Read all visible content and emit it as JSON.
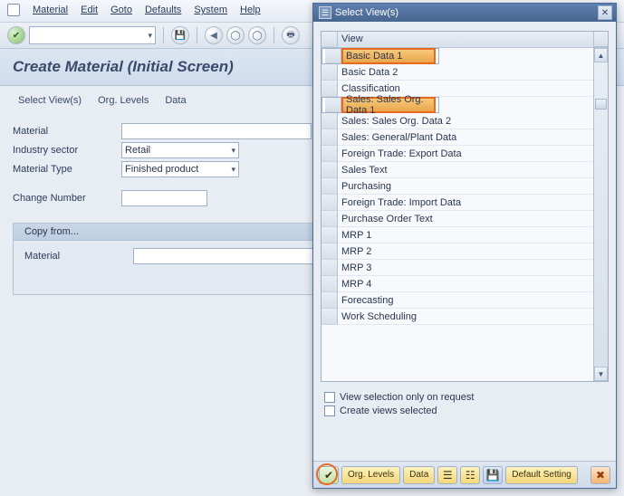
{
  "menubar": {
    "items": [
      "Material",
      "Edit",
      "Goto",
      "Defaults",
      "System",
      "Help"
    ]
  },
  "page_title": "Create Material (Initial Screen)",
  "subtabs": [
    "Select View(s)",
    "Org. Levels",
    "Data"
  ],
  "form": {
    "material_label": "Material",
    "industry_label": "Industry sector",
    "industry_value": "Retail",
    "mtype_label": "Material Type",
    "mtype_value": "Finished product",
    "changeno_label": "Change Number"
  },
  "copybox": {
    "title": "Copy from...",
    "material_label": "Material"
  },
  "dialog": {
    "title": "Select View(s)",
    "header_label": "View",
    "items": [
      {
        "label": "Basic Data 1",
        "selected": true
      },
      {
        "label": "Basic Data 2",
        "selected": false
      },
      {
        "label": "Classification",
        "selected": false
      },
      {
        "label": "Sales: Sales Org. Data 1",
        "selected": true
      },
      {
        "label": "Sales: Sales Org. Data 2",
        "selected": false
      },
      {
        "label": "Sales: General/Plant Data",
        "selected": false
      },
      {
        "label": "Foreign Trade: Export Data",
        "selected": false
      },
      {
        "label": "Sales Text",
        "selected": false
      },
      {
        "label": "Purchasing",
        "selected": false
      },
      {
        "label": "Foreign Trade: Import Data",
        "selected": false
      },
      {
        "label": "Purchase Order Text",
        "selected": false
      },
      {
        "label": "MRP 1",
        "selected": false
      },
      {
        "label": "MRP 2",
        "selected": false
      },
      {
        "label": "MRP 3",
        "selected": false
      },
      {
        "label": "MRP 4",
        "selected": false
      },
      {
        "label": "Forecasting",
        "selected": false
      },
      {
        "label": "Work Scheduling",
        "selected": false
      }
    ],
    "cb1": "View selection only on request",
    "cb2": "Create views selected",
    "footer": {
      "org": "Org. Levels",
      "data": "Data",
      "default": "Default Setting"
    }
  }
}
